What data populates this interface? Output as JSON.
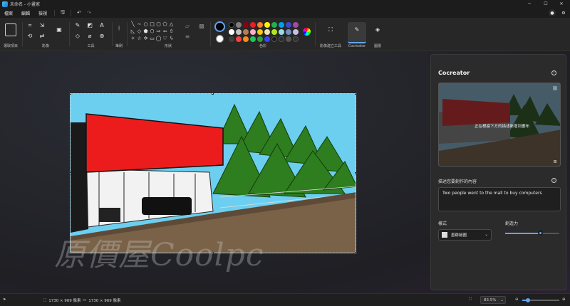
{
  "window": {
    "title": "未命名 - 小畫家"
  },
  "menubar": {
    "items": [
      "檔案",
      "編輯",
      "檢視"
    ]
  },
  "ribbon": {
    "groups": {
      "select": "選取項目",
      "image": "影像",
      "tools": "工具",
      "brushes": "筆刷",
      "shapes": "形狀",
      "colors": "色彩",
      "image_creator": "影像建立工具",
      "cocreator": "Cocreator",
      "layers": "圖層"
    },
    "swatches": [
      "#000000",
      "#7f7f7f",
      "#880015",
      "#ed1c24",
      "#ff7f27",
      "#fff200",
      "#22b14c",
      "#00a2e8",
      "#3f48cc",
      "#a349a4",
      "#ffffff",
      "#c3c3c3",
      "#b97a57",
      "#ffaec9",
      "#ffc90e",
      "#efe4b0",
      "#b5e61d",
      "#99d9ea",
      "#7092be",
      "#c8bfe7",
      "#404040",
      "#ff4040",
      "#ff8c1a",
      "#22c45e",
      "#2e9e3e",
      "#4040ff",
      "#1a1a1a",
      "#2a2a2a",
      "#555555",
      "#303030"
    ]
  },
  "cocreator": {
    "title": "Cocreator",
    "overlay_text": "正在根據下方的描述新增到畫布",
    "prompt_label": "描述您要創作的內容",
    "prompt_value": "Two people went to the mall to buy computers",
    "style_label": "樣式",
    "style_value": "墨跡繪圖",
    "creativity_label": "創造力",
    "creativity_value": 0.65
  },
  "watermark": {
    "text": "原價屋Coolpc"
  },
  "statusbar": {
    "selection_size": "1730 × 969 像素",
    "canvas_size": "1730 × 969 像素",
    "zoom": "83.5%",
    "zoom_level": 0.15
  }
}
